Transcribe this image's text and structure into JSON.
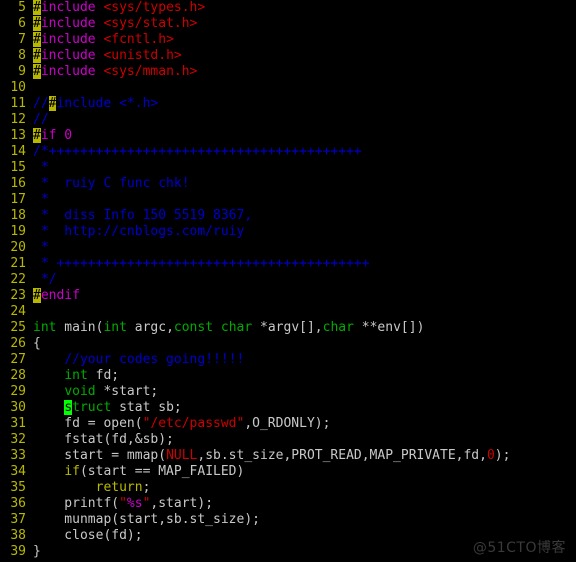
{
  "editor": {
    "theme": "terminal-dark",
    "colors": {
      "background": "#000000",
      "line_number": "#b8b800",
      "preprocessor": "#cc00cc",
      "header_include": "#cc0000",
      "comment": "#0000cc",
      "type_keyword": "#00aa00",
      "control_keyword": "#b8b800",
      "string_literal": "#cc0000",
      "format_specifier": "#cc00cc",
      "plain_text": "#c8c8c8",
      "hash_highlight_bg": "#b8b800",
      "cursor_bg": "#00ff00",
      "watermark": "#3a3a3a"
    },
    "cursor": {
      "line": 30,
      "column": 5,
      "character": "s"
    },
    "first_visible_line": 5,
    "last_visible_line": 39,
    "lines": [
      {
        "n": "5",
        "tokens": [
          {
            "t": "#",
            "c": "hash"
          },
          {
            "t": "include",
            "c": "pre"
          },
          {
            "t": " ",
            "c": "plain"
          },
          {
            "t": "<sys/types.h>",
            "c": "hdr"
          }
        ]
      },
      {
        "n": "6",
        "tokens": [
          {
            "t": "#",
            "c": "hash"
          },
          {
            "t": "include",
            "c": "pre"
          },
          {
            "t": " ",
            "c": "plain"
          },
          {
            "t": "<sys/stat.h>",
            "c": "hdr"
          }
        ]
      },
      {
        "n": "7",
        "tokens": [
          {
            "t": "#",
            "c": "hash"
          },
          {
            "t": "include",
            "c": "pre"
          },
          {
            "t": " ",
            "c": "plain"
          },
          {
            "t": "<fcntl.h>",
            "c": "hdr"
          }
        ]
      },
      {
        "n": "8",
        "tokens": [
          {
            "t": "#",
            "c": "hash"
          },
          {
            "t": "include",
            "c": "pre"
          },
          {
            "t": " ",
            "c": "plain"
          },
          {
            "t": "<unistd.h>",
            "c": "hdr"
          }
        ]
      },
      {
        "n": "9",
        "tokens": [
          {
            "t": "#",
            "c": "hash"
          },
          {
            "t": "include",
            "c": "pre"
          },
          {
            "t": " ",
            "c": "plain"
          },
          {
            "t": "<sys/mman.h>",
            "c": "hdr"
          }
        ]
      },
      {
        "n": "10",
        "tokens": []
      },
      {
        "n": "11",
        "tokens": [
          {
            "t": "//",
            "c": "cmt"
          },
          {
            "t": "#",
            "c": "hash"
          },
          {
            "t": "include <*.h>",
            "c": "cmt"
          }
        ]
      },
      {
        "n": "12",
        "tokens": [
          {
            "t": "//",
            "c": "cmt"
          }
        ]
      },
      {
        "n": "13",
        "tokens": [
          {
            "t": "#",
            "c": "hash"
          },
          {
            "t": "if 0",
            "c": "pre"
          }
        ]
      },
      {
        "n": "14",
        "tokens": [
          {
            "t": "/*++++++++++++++++++++++++++++++++++++++++",
            "c": "cmt"
          }
        ]
      },
      {
        "n": "15",
        "tokens": [
          {
            "t": " *",
            "c": "cmt"
          }
        ]
      },
      {
        "n": "16",
        "tokens": [
          {
            "t": " *  ruiy C func chk!",
            "c": "cmt"
          }
        ]
      },
      {
        "n": "17",
        "tokens": [
          {
            "t": " *",
            "c": "cmt"
          }
        ]
      },
      {
        "n": "18",
        "tokens": [
          {
            "t": " *  diss Info 150 5519 8367,",
            "c": "cmt"
          }
        ]
      },
      {
        "n": "19",
        "tokens": [
          {
            "t": " *  http://cnblogs.com/ruiy",
            "c": "cmt"
          }
        ]
      },
      {
        "n": "20",
        "tokens": [
          {
            "t": " *",
            "c": "cmt"
          }
        ]
      },
      {
        "n": "21",
        "tokens": [
          {
            "t": " * ++++++++++++++++++++++++++++++++++++++++",
            "c": "cmt"
          }
        ]
      },
      {
        "n": "22",
        "tokens": [
          {
            "t": " */",
            "c": "cmt"
          }
        ]
      },
      {
        "n": "23",
        "tokens": [
          {
            "t": "#",
            "c": "hash"
          },
          {
            "t": "endif",
            "c": "pre"
          }
        ]
      },
      {
        "n": "24",
        "tokens": []
      },
      {
        "n": "25",
        "tokens": [
          {
            "t": "int",
            "c": "kw"
          },
          {
            "t": " main(",
            "c": "plain"
          },
          {
            "t": "int",
            "c": "kw"
          },
          {
            "t": " argc,",
            "c": "plain"
          },
          {
            "t": "const",
            "c": "kw"
          },
          {
            "t": " ",
            "c": "plain"
          },
          {
            "t": "char",
            "c": "kw"
          },
          {
            "t": " *argv[],",
            "c": "plain"
          },
          {
            "t": "char",
            "c": "kw"
          },
          {
            "t": " **env[])",
            "c": "plain"
          }
        ]
      },
      {
        "n": "26",
        "tokens": [
          {
            "t": "{",
            "c": "plain"
          }
        ]
      },
      {
        "n": "27",
        "tokens": [
          {
            "t": "    ",
            "c": "plain"
          },
          {
            "t": "//your codes going!!!!!",
            "c": "cmt"
          }
        ]
      },
      {
        "n": "28",
        "tokens": [
          {
            "t": "    ",
            "c": "plain"
          },
          {
            "t": "int",
            "c": "kw"
          },
          {
            "t": " fd;",
            "c": "plain"
          }
        ]
      },
      {
        "n": "29",
        "tokens": [
          {
            "t": "    ",
            "c": "plain"
          },
          {
            "t": "void",
            "c": "kw"
          },
          {
            "t": " *start;",
            "c": "plain"
          }
        ]
      },
      {
        "n": "30",
        "tokens": [
          {
            "t": "    ",
            "c": "plain"
          },
          {
            "t": "s",
            "c": "cursor"
          },
          {
            "t": "truct",
            "c": "kw"
          },
          {
            "t": " stat sb;",
            "c": "plain"
          }
        ]
      },
      {
        "n": "31",
        "tokens": [
          {
            "t": "    fd = open(",
            "c": "plain"
          },
          {
            "t": "\"/etc/passwd\"",
            "c": "str"
          },
          {
            "t": ",O_RDONLY);",
            "c": "plain"
          }
        ]
      },
      {
        "n": "32",
        "tokens": [
          {
            "t": "    fstat(fd,&sb);",
            "c": "plain"
          }
        ]
      },
      {
        "n": "33",
        "tokens": [
          {
            "t": "    start = mmap(",
            "c": "plain"
          },
          {
            "t": "NULL",
            "c": "str"
          },
          {
            "t": ",sb.st_size,PROT_READ,MAP_PRIVATE,fd,",
            "c": "plain"
          },
          {
            "t": "0",
            "c": "str"
          },
          {
            "t": ");",
            "c": "plain"
          }
        ]
      },
      {
        "n": "34",
        "tokens": [
          {
            "t": "    ",
            "c": "plain"
          },
          {
            "t": "if",
            "c": "ctl"
          },
          {
            "t": "(start == MAP_FAILED)",
            "c": "plain"
          }
        ]
      },
      {
        "n": "35",
        "tokens": [
          {
            "t": "        ",
            "c": "plain"
          },
          {
            "t": "return",
            "c": "ctl"
          },
          {
            "t": ";",
            "c": "plain"
          }
        ]
      },
      {
        "n": "36",
        "tokens": [
          {
            "t": "    printf(",
            "c": "plain"
          },
          {
            "t": "\"",
            "c": "str"
          },
          {
            "t": "%s",
            "c": "fmt"
          },
          {
            "t": "\"",
            "c": "str"
          },
          {
            "t": ",start);",
            "c": "plain"
          }
        ]
      },
      {
        "n": "37",
        "tokens": [
          {
            "t": "    munmap(start,sb.st_size);",
            "c": "plain"
          }
        ]
      },
      {
        "n": "38",
        "tokens": [
          {
            "t": "    close(fd);",
            "c": "plain"
          }
        ]
      },
      {
        "n": "39",
        "tokens": [
          {
            "t": "}",
            "c": "plain"
          }
        ]
      }
    ]
  },
  "watermark": {
    "text": "@51CTO博客"
  }
}
